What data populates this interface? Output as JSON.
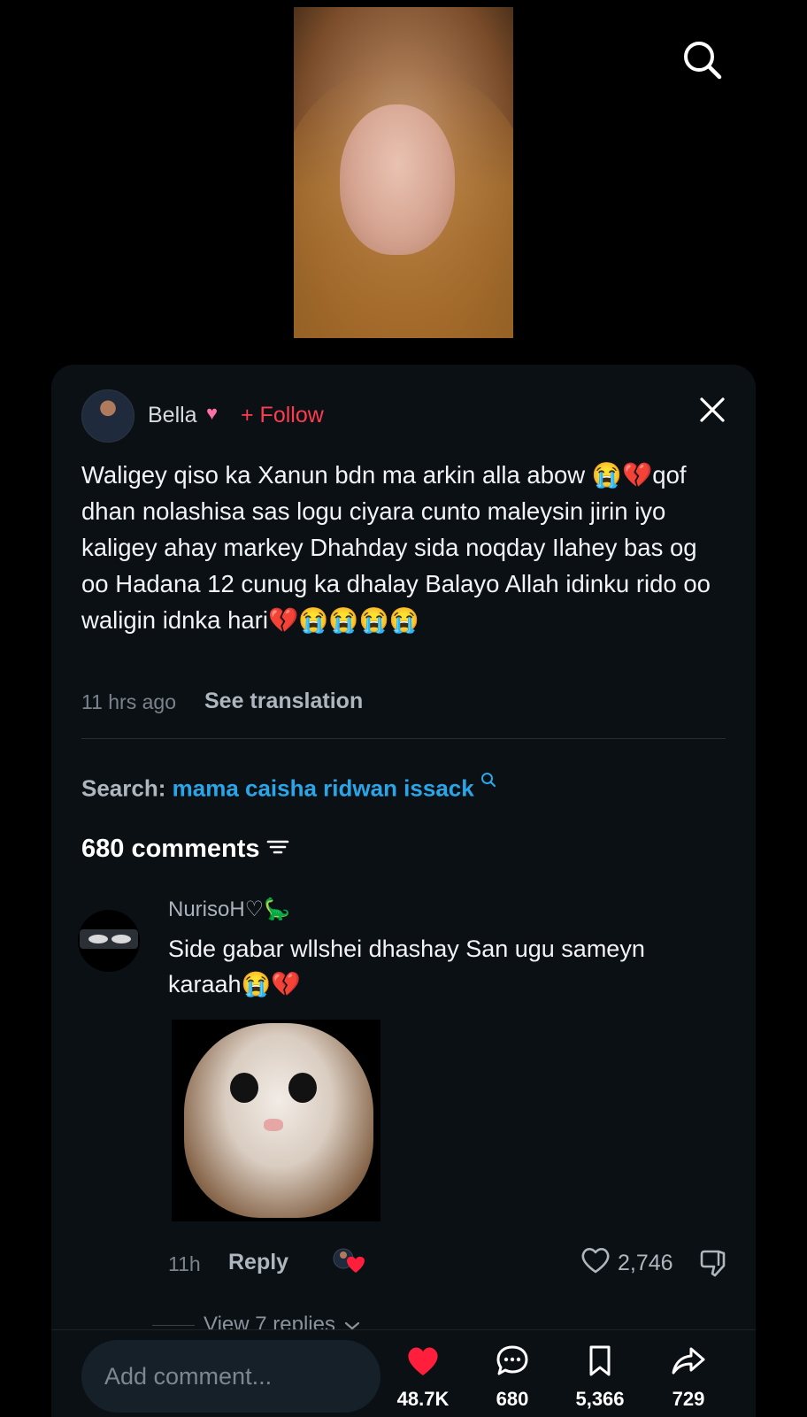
{
  "post": {
    "author": "Bella",
    "author_emoji": "♥",
    "follow_label": "+ Follow",
    "caption": "Waligey qiso ka Xanun bdn ma arkin alla abow 😭💔qof dhan nolashisa sas logu ciyara cunto maleysin jirin iyo kaligey ahay markey Dhahday sida noqday Ilahey bas og oo Hadana 12 cunug ka dhalay Balayo Allah idinku rido oo waligin idnka hari💔😭😭😭😭",
    "time": "11 hrs ago",
    "see_translation": "See translation"
  },
  "search": {
    "label": "Search:",
    "term": "mama caisha ridwan issack"
  },
  "comments": {
    "count_label": "680 comments",
    "items": [
      {
        "user": "NurisoH♡🦕",
        "text": "Side gabar wllshei dhashay San ugu sameyn karaah😭💔",
        "time": "11h",
        "reply_label": "Reply",
        "likes": "2,746",
        "view_replies": "View 7 replies"
      }
    ]
  },
  "bottom": {
    "input_placeholder": "Add comment...",
    "likes": "48.7K",
    "comments": "680",
    "saves": "5,366",
    "shares": "729"
  },
  "colors": {
    "follow": "#ff3b4e",
    "search_term": "#2aa6e8",
    "like_heart": "#ff1f3d",
    "sheet_bg": "#0b1015"
  }
}
